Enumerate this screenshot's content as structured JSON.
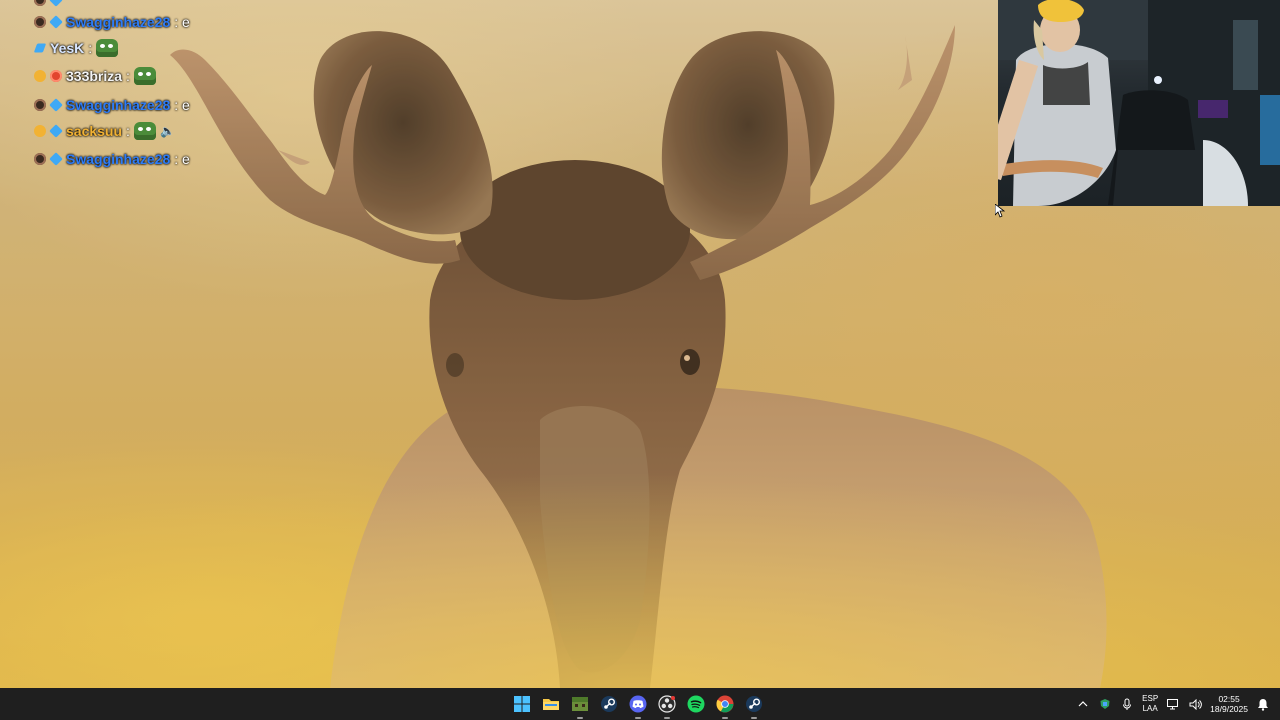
{
  "chat": {
    "messages": [
      {
        "badges": [
          "mod",
          "cube"
        ],
        "user": "Swagginhaze28",
        "user_color": "#2e7cf6",
        "text": "e"
      },
      {
        "badges": [
          "check"
        ],
        "user": "YesK",
        "user_color": "#d8e6ff",
        "emote": "pepe-emote"
      },
      {
        "badges": [
          "gold",
          "red"
        ],
        "user": "333briza",
        "user_color": "#f3f3f3",
        "emote": "pepe-emote"
      },
      {
        "badges": [
          "mod",
          "cube"
        ],
        "user": "Swagginhaze28",
        "user_color": "#2e7cf6",
        "text": "e"
      },
      {
        "badges": [
          "gold",
          "cube"
        ],
        "user": "sacksuu",
        "user_color": "#f2b233",
        "emote": "pepe-emote",
        "extra": "speaker-icon"
      },
      {
        "badges": [
          "mod",
          "cube"
        ],
        "user": "Swagginhaze28",
        "user_color": "#2e7cf6",
        "text": "e"
      }
    ]
  },
  "taskbar": {
    "apps": [
      {
        "name": "start",
        "icon": "windows-logo-icon"
      },
      {
        "name": "file-explorer",
        "icon": "folder-icon"
      },
      {
        "name": "minecraft",
        "icon": "minecraft-icon"
      },
      {
        "name": "steam",
        "icon": "steam-icon"
      },
      {
        "name": "discord",
        "icon": "discord-icon"
      },
      {
        "name": "obs",
        "icon": "obs-icon"
      },
      {
        "name": "spotify",
        "icon": "spotify-icon"
      },
      {
        "name": "chrome",
        "icon": "chrome-icon"
      },
      {
        "name": "steam-2",
        "icon": "steam-icon"
      }
    ],
    "tray": {
      "lang_line1": "ESP",
      "lang_line2": "LAA",
      "time": "02:55",
      "date": "18/9/2025"
    }
  },
  "colors": {
    "taskbar_bg": "#1f1f1f",
    "accent": "#2e7cf6"
  }
}
